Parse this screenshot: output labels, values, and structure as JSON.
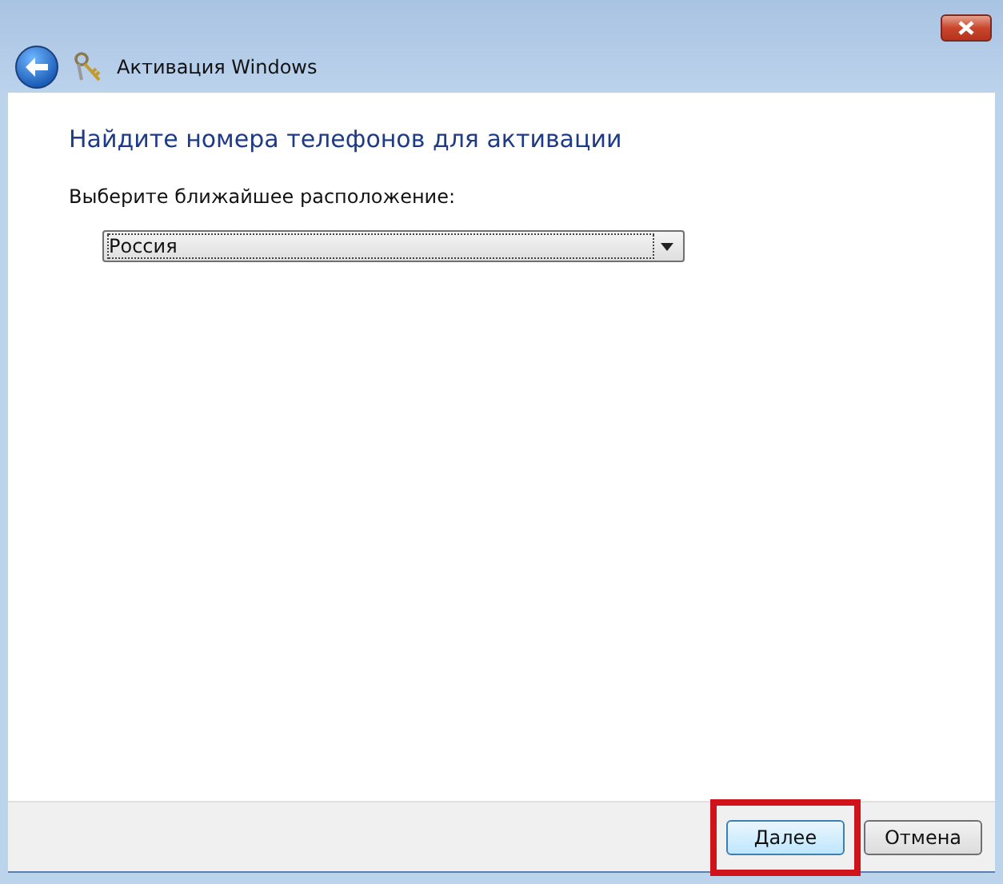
{
  "window": {
    "title": "Активация Windows"
  },
  "heading": "Найдите номера телефонов для активации",
  "location": {
    "label": "Выберите ближайшее расположение:",
    "value": "Россия"
  },
  "buttons": [
    {
      "label": "Далее",
      "default": true,
      "highlighted": true
    },
    {
      "label": "Отмена",
      "default": false,
      "highlighted": false
    }
  ]
}
